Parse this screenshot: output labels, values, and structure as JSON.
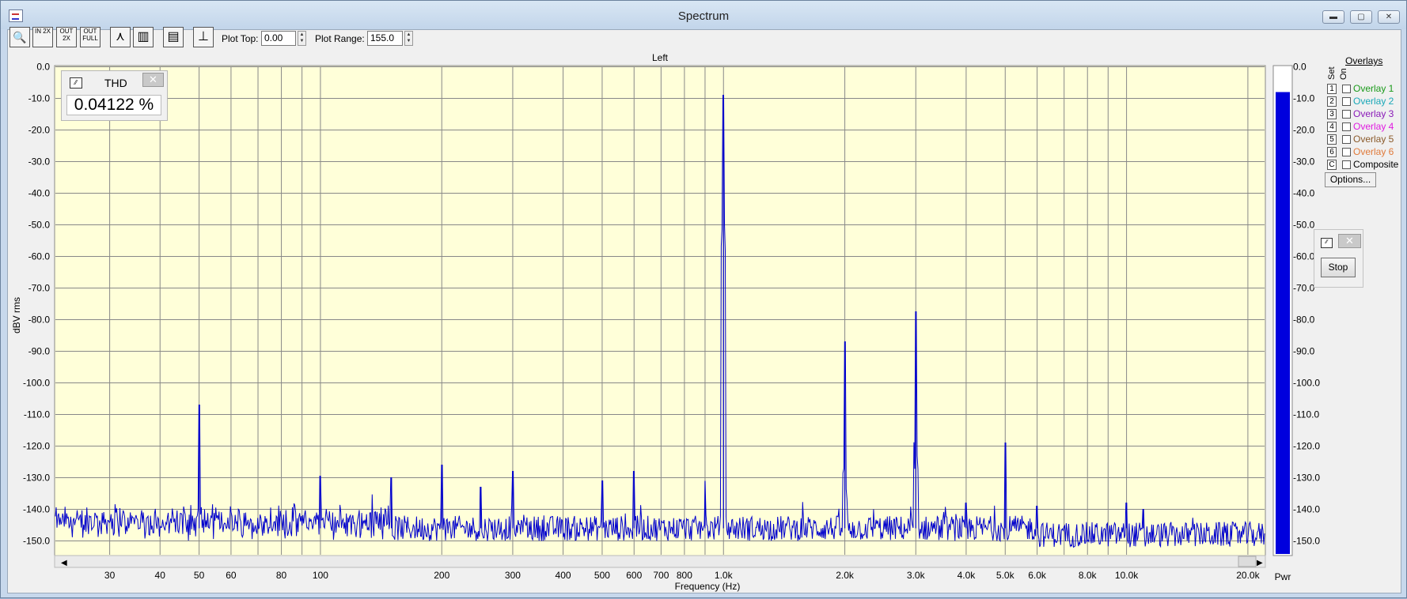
{
  "window": {
    "title": "Spectrum"
  },
  "toolbar": {
    "buttons": [
      {
        "name": "zoom-icon",
        "label": "🔍"
      },
      {
        "name": "zoom-in-2x-icon",
        "label": "IN 2X"
      },
      {
        "name": "zoom-out-2x-icon",
        "label": "OUT 2X"
      },
      {
        "name": "zoom-out-full-icon",
        "label": "OUT FULL"
      },
      {
        "name": "peak-icon",
        "label": "⋏"
      },
      {
        "name": "bars-icon",
        "label": "▥"
      },
      {
        "name": "settings-panel-icon",
        "label": "▤"
      },
      {
        "name": "range-icon",
        "label": "⊥"
      }
    ],
    "plot_top_label": "Plot Top:",
    "plot_top_value": "0.00",
    "plot_range_label": "Plot Range:",
    "plot_range_value": "155.0"
  },
  "thd": {
    "title": "THD",
    "value": "0.04122 %",
    "close": "✕"
  },
  "stop": {
    "close": "✕",
    "button": "Stop"
  },
  "overlays": {
    "title": "Overlays",
    "set_label": "Set",
    "on_label": "On",
    "items": [
      {
        "num": "1",
        "label": "Overlay 1",
        "color": "#1a9a1a"
      },
      {
        "num": "2",
        "label": "Overlay 2",
        "color": "#1aa8b8"
      },
      {
        "num": "3",
        "label": "Overlay 3",
        "color": "#8a1ab8"
      },
      {
        "num": "4",
        "label": "Overlay 4",
        "color": "#e01ae0"
      },
      {
        "num": "5",
        "label": "Overlay 5",
        "color": "#8a5a2a"
      },
      {
        "num": "6",
        "label": "Overlay 6",
        "color": "#e07a3a"
      },
      {
        "num": "C",
        "label": "Composite",
        "color": "#000000"
      }
    ],
    "options_label": "Options..."
  },
  "chart_data": {
    "type": "line",
    "title": "Left",
    "xlabel": "Frequency (Hz)",
    "ylabel": "dBV rms",
    "xscale": "log",
    "xlim": [
      22,
      22000
    ],
    "ylim": [
      -155,
      0
    ],
    "yticks": [
      "0.0",
      "-10.0",
      "-20.0",
      "-30.0",
      "-40.0",
      "-50.0",
      "-60.0",
      "-70.0",
      "-80.0",
      "-90.0",
      "-100.0",
      "-110.0",
      "-120.0",
      "-130.0",
      "-140.0",
      "-150.0"
    ],
    "xticks": [
      {
        "v": 30,
        "t": "30"
      },
      {
        "v": 40,
        "t": "40"
      },
      {
        "v": 50,
        "t": "50"
      },
      {
        "v": 60,
        "t": "60"
      },
      {
        "v": 80,
        "t": "80"
      },
      {
        "v": 100,
        "t": "100"
      },
      {
        "v": 200,
        "t": "200"
      },
      {
        "v": 300,
        "t": "300"
      },
      {
        "v": 400,
        "t": "400"
      },
      {
        "v": 500,
        "t": "500"
      },
      {
        "v": 600,
        "t": "600"
      },
      {
        "v": 700,
        "t": "700"
      },
      {
        "v": 800,
        "t": "800"
      },
      {
        "v": 1000,
        "t": "1.0k"
      },
      {
        "v": 2000,
        "t": "2.0k"
      },
      {
        "v": 3000,
        "t": "3.0k"
      },
      {
        "v": 4000,
        "t": "4.0k"
      },
      {
        "v": 5000,
        "t": "5.0k"
      },
      {
        "v": 6000,
        "t": "6.0k"
      },
      {
        "v": 8000,
        "t": "8.0k"
      },
      {
        "v": 10000,
        "t": "10.0k"
      },
      {
        "v": 20000,
        "t": "20.0k"
      }
    ],
    "grid": true,
    "noise_floor": -145,
    "series": [
      {
        "color": "#0000cc",
        "peaks": [
          {
            "f": 50,
            "db": -107
          },
          {
            "f": 100,
            "db": -129.5
          },
          {
            "f": 150,
            "db": -130
          },
          {
            "f": 200,
            "db": -126
          },
          {
            "f": 250,
            "db": -133
          },
          {
            "f": 300,
            "db": -128
          },
          {
            "f": 500,
            "db": -131
          },
          {
            "f": 600,
            "db": -128
          },
          {
            "f": 900,
            "db": -131
          },
          {
            "f": 1000,
            "db": -9
          },
          {
            "f": 2000,
            "db": -87
          },
          {
            "f": 3000,
            "db": -77.5
          },
          {
            "f": 4000,
            "db": -138
          },
          {
            "f": 5000,
            "db": -119
          },
          {
            "f": 6000,
            "db": -139
          },
          {
            "f": 10000,
            "db": -138
          },
          {
            "f": 11000,
            "db": -140
          }
        ]
      }
    ],
    "meter": {
      "label": "Pwr",
      "level_db": -8
    }
  }
}
